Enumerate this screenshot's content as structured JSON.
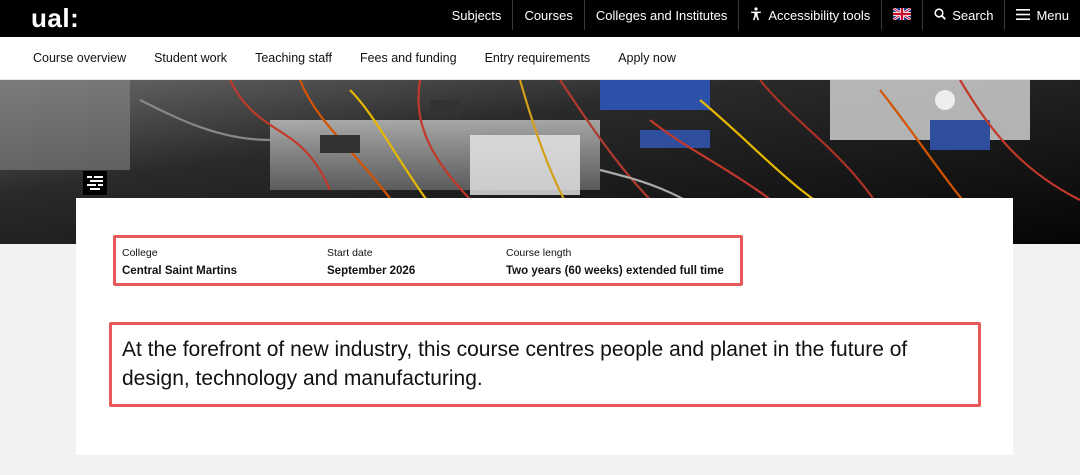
{
  "header": {
    "logo": "ual:",
    "nav": [
      {
        "label": "Subjects"
      },
      {
        "label": "Courses"
      },
      {
        "label": "Colleges and Institutes"
      },
      {
        "label": "Accessibility tools",
        "icon": "accessibility-icon"
      },
      {
        "label": "",
        "icon": "uk-flag-icon"
      },
      {
        "label": "Search",
        "icon": "search-icon"
      },
      {
        "label": "Menu",
        "icon": "hamburger-icon"
      }
    ]
  },
  "subnav": {
    "items": [
      {
        "label": "Course overview"
      },
      {
        "label": "Student work"
      },
      {
        "label": "Teaching staff"
      },
      {
        "label": "Fees and funding"
      },
      {
        "label": "Entry requirements"
      },
      {
        "label": "Apply now"
      }
    ]
  },
  "hero": {
    "image": "lab-cables-photo",
    "toc_icon": "table-of-contents-icon"
  },
  "course": {
    "college_label": "College",
    "college_value": "Central Saint Martins",
    "start_label": "Start date",
    "start_value": "September 2026",
    "length_label": "Course length",
    "length_value": "Two years (60 weeks) extended full time",
    "summary": "At the forefront of new industry, this course centres people and planet in the future of design, technology and manufacturing."
  },
  "colors": {
    "highlight": "#e85a5a",
    "topbar": "#000000",
    "page_bg": "#f2f2f2"
  }
}
